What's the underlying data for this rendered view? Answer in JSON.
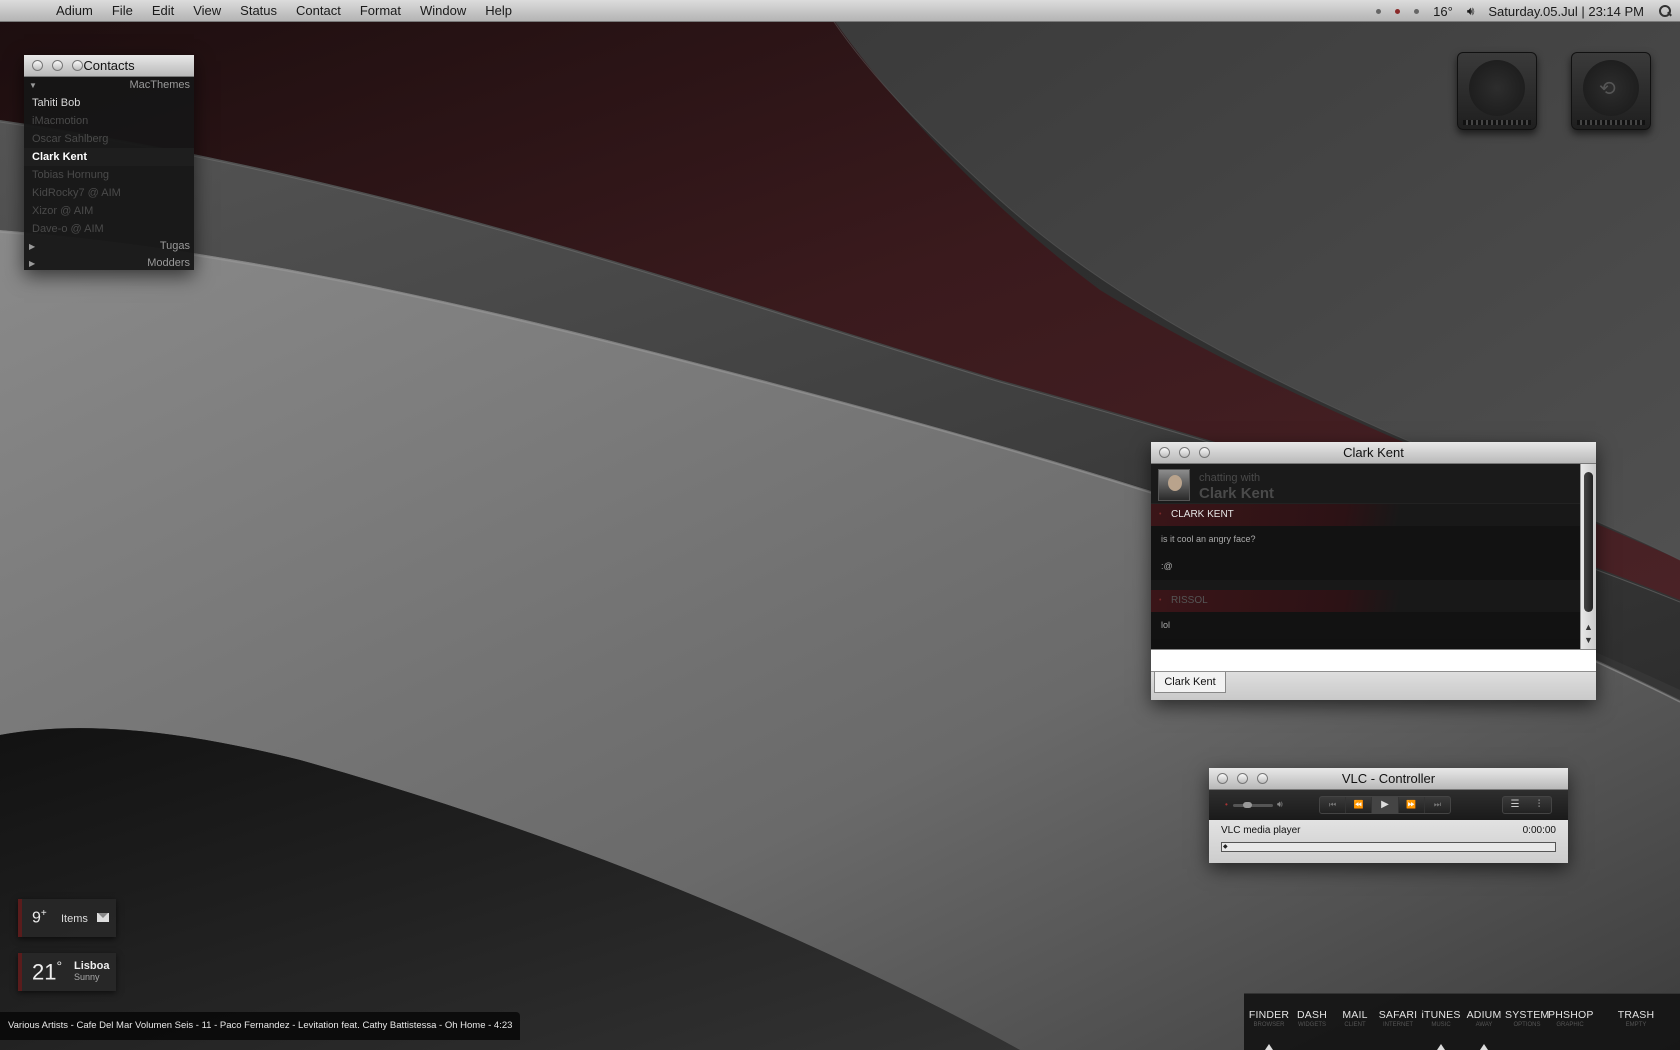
{
  "menubar": {
    "apple_icon": "",
    "app_name": "Adium",
    "menus": [
      "File",
      "Edit",
      "View",
      "Status",
      "Contact",
      "Format",
      "Window",
      "Help"
    ],
    "temperature": "16°",
    "datetime": "Saturday.05.Jul | 23:14 PM"
  },
  "contacts": {
    "title": "Contacts",
    "groups": [
      {
        "name": "MacThemes",
        "expanded": true,
        "members": [
          {
            "name": "Tahiti Bob",
            "status": "online"
          },
          {
            "name": "iMacmotion",
            "status": "offline"
          },
          {
            "name": "Oscar Sahlberg",
            "status": "offline"
          },
          {
            "name": "Clark Kent",
            "status": "active"
          },
          {
            "name": "Tobias Hornung",
            "status": "offline"
          },
          {
            "name": "KidRocky7 @ AIM",
            "status": "offline"
          },
          {
            "name": "Xizor @ AIM",
            "status": "offline"
          },
          {
            "name": "Dave-o @ AIM",
            "status": "offline"
          }
        ]
      },
      {
        "name": "Tugas",
        "expanded": false
      },
      {
        "name": "Modders",
        "expanded": false
      }
    ]
  },
  "disks": [
    {
      "name": "system-disk",
      "icon": "apple-logo-icon"
    },
    {
      "name": "time-machine-disk",
      "icon": "time-machine-icon"
    }
  ],
  "chat": {
    "title": "Clark Kent",
    "chatting_with_label": "chatting with",
    "chatting_with_name": "Clark Kent",
    "messages": [
      {
        "sender": "CLARK KENT",
        "lines": [
          "is it cool an angry face?",
          ":@"
        ]
      },
      {
        "sender": "RISSOL",
        "lines": [
          "lol"
        ]
      }
    ],
    "input_value": "",
    "tab_label": "Clark Kent"
  },
  "vlc": {
    "title": "VLC - Controller",
    "now_playing": "VLC media player",
    "time": "0:00:00",
    "volume_level": 0.35,
    "progress": 0
  },
  "mail_widget": {
    "count": "9",
    "count_suffix": "+",
    "label": "Items"
  },
  "weather_widget": {
    "temperature": "21",
    "degree": "°",
    "city": "Lisboa",
    "condition": "Sunny"
  },
  "now_playing_bar": "Various Artists - Cafe Del Mar Volumen Seis - 11 - Paco Fernandez - Levitation feat. Cathy Battistessa - Oh Home - 4:23",
  "dock": [
    {
      "name": "FINDER",
      "sub": "BROWSER",
      "running": true
    },
    {
      "name": "DASH",
      "sub": "WIDGETS",
      "running": false
    },
    {
      "name": "MAIL",
      "sub": "CLIENT",
      "running": false
    },
    {
      "name": "SAFARI",
      "sub": "INTERNET",
      "running": false
    },
    {
      "name": "iTUNES",
      "sub": "MUSIC",
      "running": true
    },
    {
      "name": "ADIUM",
      "sub": "AWAY",
      "running": true
    },
    {
      "name": "SYSTEM",
      "sub": "OPTIONS",
      "running": false
    },
    {
      "name": "PHSHOP",
      "sub": "GRAPHIC",
      "running": false
    },
    {
      "name": "TRASH",
      "sub": "EMPTY",
      "running": false
    }
  ],
  "colors": {
    "accent_red": "#5a1c1c",
    "menubar": "#c8c8c8",
    "wallpaper_dark": "#1a1a1a"
  }
}
